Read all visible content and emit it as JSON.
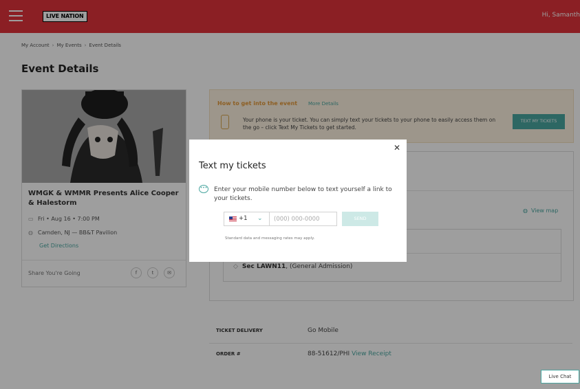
{
  "header": {
    "logo": "LIVE NATION",
    "greeting": "Hi, Samanth"
  },
  "breadcrumb": {
    "items": [
      "My Account",
      "My Events",
      "Event Details"
    ],
    "separator": "›"
  },
  "page_title": "Event Details",
  "event": {
    "name": "WMGK & WMMR Presents Alice Cooper & Halestorm",
    "date": "Fri • Aug 16 • 7:00 PM",
    "venue": "Camden, NJ — BB&T Pavilion",
    "directions_link": "Get Directions",
    "share_label": "Share You're Going",
    "share_buttons": [
      "f",
      "t",
      "✉"
    ]
  },
  "how_to": {
    "title": "How to get into the event",
    "more_link": "More Details",
    "text": "Your phone is your ticket. You can simply text your tickets to your phone to easily access them on the go – click Text My Tickets to get started.",
    "button": "TEXT MY TICKETS"
  },
  "tickets": {
    "view_map": "View map",
    "seat_section": "Sec LAWN11",
    "seat_type": ", (General Admission)"
  },
  "order_info": {
    "delivery_label": "TICKET DELIVERY",
    "delivery_value": "Go Mobile",
    "order_label": "ORDER #",
    "order_value": "88-51612/PHI",
    "receipt_link": "View Receipt"
  },
  "live_chat": "Live Chat",
  "modal": {
    "title": "Text my tickets",
    "message": "Enter your mobile number below to text yourself a link to your tickets.",
    "country_code": "+1",
    "phone_placeholder": "(000) 000-0000",
    "send_button": "SEND",
    "disclaimer": "Standard data and messaging rates may apply."
  },
  "colors": {
    "brand_red": "#e0323b",
    "accent_teal": "#4aa6a0",
    "info_bg": "#fdf2e0",
    "info_title": "#e49a3a"
  }
}
